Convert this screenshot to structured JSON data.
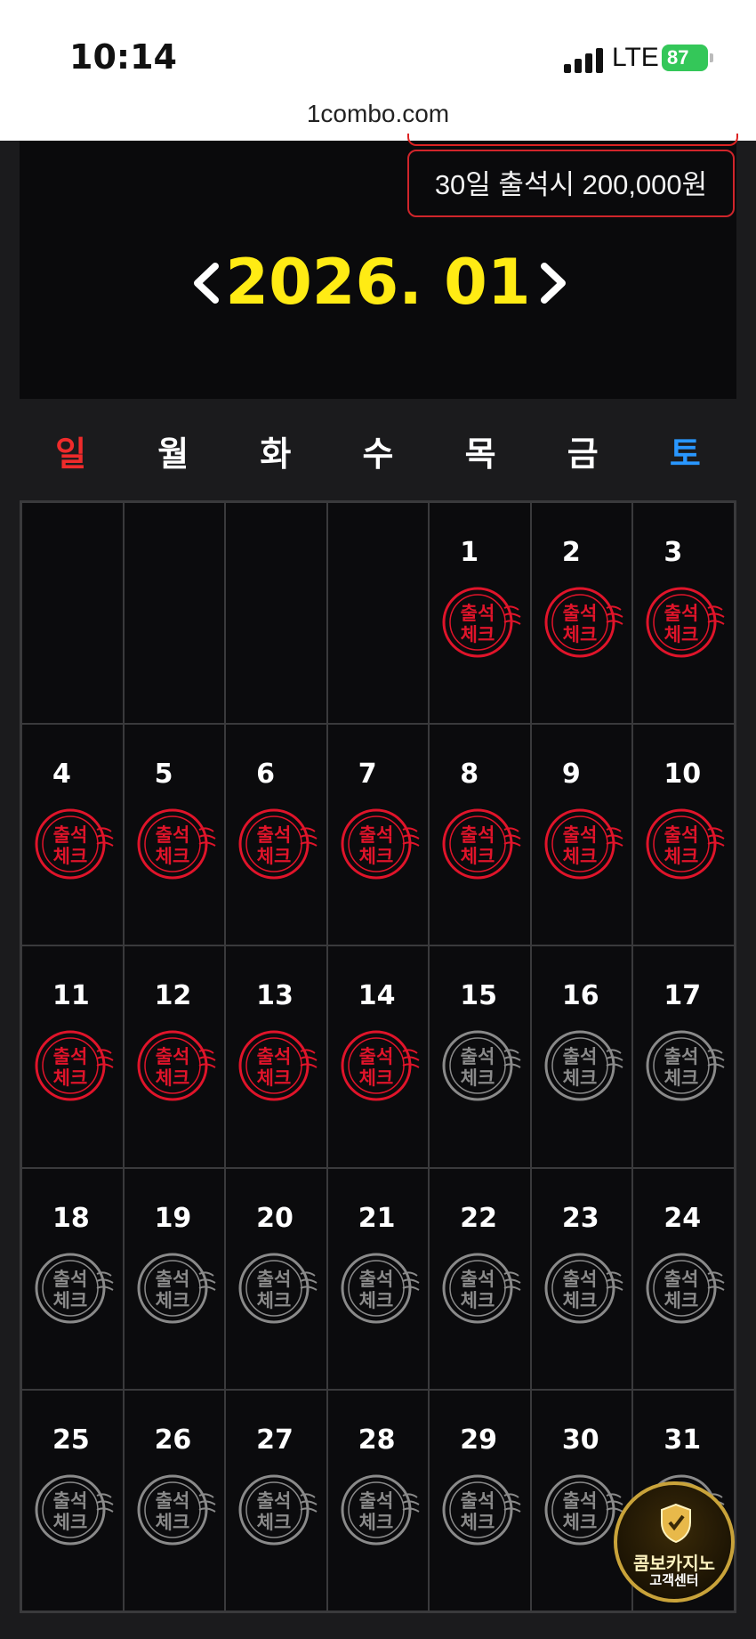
{
  "status_bar": {
    "time": "10:14",
    "network": "LTE",
    "battery": "87"
  },
  "browser": {
    "url": "1combo.com"
  },
  "reward_banner": "30일 출석시 200,000원",
  "calendar": {
    "month_title": "2026. 01",
    "weekdays": [
      "일",
      "월",
      "화",
      "수",
      "목",
      "금",
      "토"
    ],
    "stamp_label": "출석 체크",
    "leading_blank_days": 4,
    "checked_days": [
      1,
      2,
      3,
      4,
      5,
      6,
      7,
      8,
      9,
      10,
      11,
      12,
      13,
      14
    ],
    "days": [
      "1",
      "2",
      "3",
      "4",
      "5",
      "6",
      "7",
      "8",
      "9",
      "10",
      "11",
      "12",
      "13",
      "14",
      "15",
      "16",
      "17",
      "18",
      "19",
      "20",
      "21",
      "22",
      "23",
      "24",
      "25",
      "26",
      "27",
      "28",
      "29",
      "30",
      "31"
    ]
  },
  "support_badge": {
    "line1": "콤보카지노",
    "line2": "고객센터"
  },
  "colors": {
    "accent_yellow": "#ffeb14",
    "stamp_red": "#e0142a",
    "stamp_gray": "#8a8a8a",
    "sunday": "#ef2b2b",
    "saturday": "#2997ff"
  }
}
